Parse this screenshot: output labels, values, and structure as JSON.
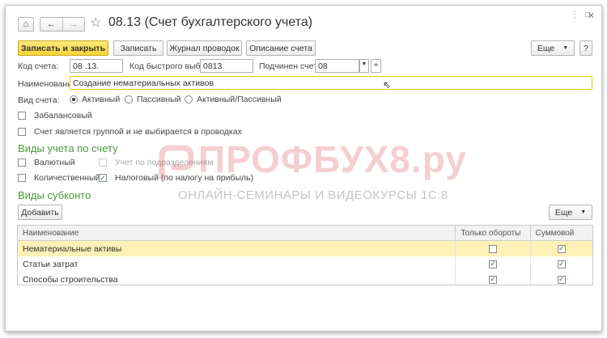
{
  "window": {
    "title": "08.13 (Счет бухгалтерского учета)",
    "icons": [
      "home-icon",
      "back-arrow-icon",
      "forward-arrow-icon",
      "star-icon",
      "more-vertical-icon",
      "maximize-icon",
      "close-icon"
    ]
  },
  "toolbar": {
    "save_close": "Записать и закрыть",
    "save": "Записать",
    "journal": "Журнал проводок",
    "description": "Описание счета",
    "more": "Еще",
    "help": "?"
  },
  "fields": {
    "code_label": "Код счета:",
    "code_value": "08 .13.",
    "quick_code_label": "Код быстрого выбора:",
    "quick_code_value": "0813",
    "parent_label": "Подчинен счету:",
    "parent_value": "08",
    "name_label": "Наименование:",
    "name_value": "Создание нематериальных активов"
  },
  "account_type": {
    "label": "Вид счета:",
    "options": [
      "Активный",
      "Пассивный",
      "Активный/Пассивный"
    ],
    "selected": "Активный"
  },
  "checks": {
    "off_balance": "Забалансовый",
    "is_group": "Счет является группой и не выбирается в проводках"
  },
  "accounting_types": {
    "heading": "Виды учета по счету",
    "currency": "Валютный",
    "by_division": "Учет по подразделениям",
    "quantity": "Количественный",
    "tax": "Налоговый (по налогу на прибыль)"
  },
  "subconto": {
    "heading": "Виды субконто",
    "add": "Добавить",
    "more": "Еще",
    "columns": [
      "Наименование",
      "Только обороты",
      "Суммовой"
    ],
    "rows": [
      {
        "name": "Нематериальные активы",
        "turnover_only": false,
        "sum": true
      },
      {
        "name": "Статьи затрат",
        "turnover_only": true,
        "sum": true
      },
      {
        "name": "Способы строительства",
        "turnover_only": true,
        "sum": true
      }
    ]
  },
  "watermark": {
    "title": "ПРОФБУХ8.ру",
    "subtitle": "ОНЛАЙН-СЕМИНАРЫ И ВИДЕОКУРСЫ 1С:8"
  },
  "colors": {
    "primary_button": "#f7d438",
    "section_heading": "#4a9a3a",
    "selected_row": "#fdf1b8",
    "watermark": "#dc505a"
  }
}
